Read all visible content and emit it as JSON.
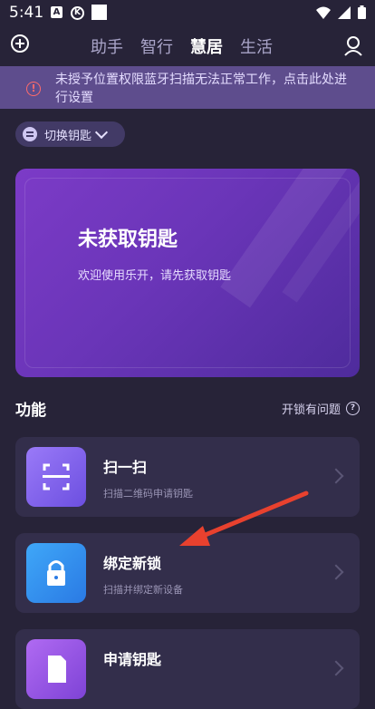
{
  "status_bar": {
    "time": "5:41",
    "a_icon": "A",
    "k_icon": "K"
  },
  "nav": {
    "tabs": [
      {
        "label": "助手",
        "active": false
      },
      {
        "label": "智行",
        "active": false
      },
      {
        "label": "慧居",
        "active": true
      },
      {
        "label": "生活",
        "active": false
      }
    ]
  },
  "warning": {
    "text": "未授予位置权限蓝牙扫描无法正常工作，点击此处进行设置"
  },
  "switch_key": {
    "label": "切换钥匙"
  },
  "key_card": {
    "title": "未获取钥匙",
    "subtitle": "欢迎使用乐开，请先获取钥匙"
  },
  "functions": {
    "heading": "功能",
    "help_label": "开锁有问题",
    "items": [
      {
        "name": "扫一扫",
        "desc": "扫描二维码申请钥匙",
        "icon": "scan-icon"
      },
      {
        "name": "绑定新锁",
        "desc": "扫描并绑定新设备",
        "icon": "lock-icon"
      },
      {
        "name": "申请钥匙",
        "desc": "",
        "icon": "apply-key-icon"
      }
    ]
  },
  "colors": {
    "accent": "#7c3bc7",
    "background": "#272338",
    "warning_bg": "#5e4d8d",
    "annotation_arrow": "#e8412e"
  }
}
